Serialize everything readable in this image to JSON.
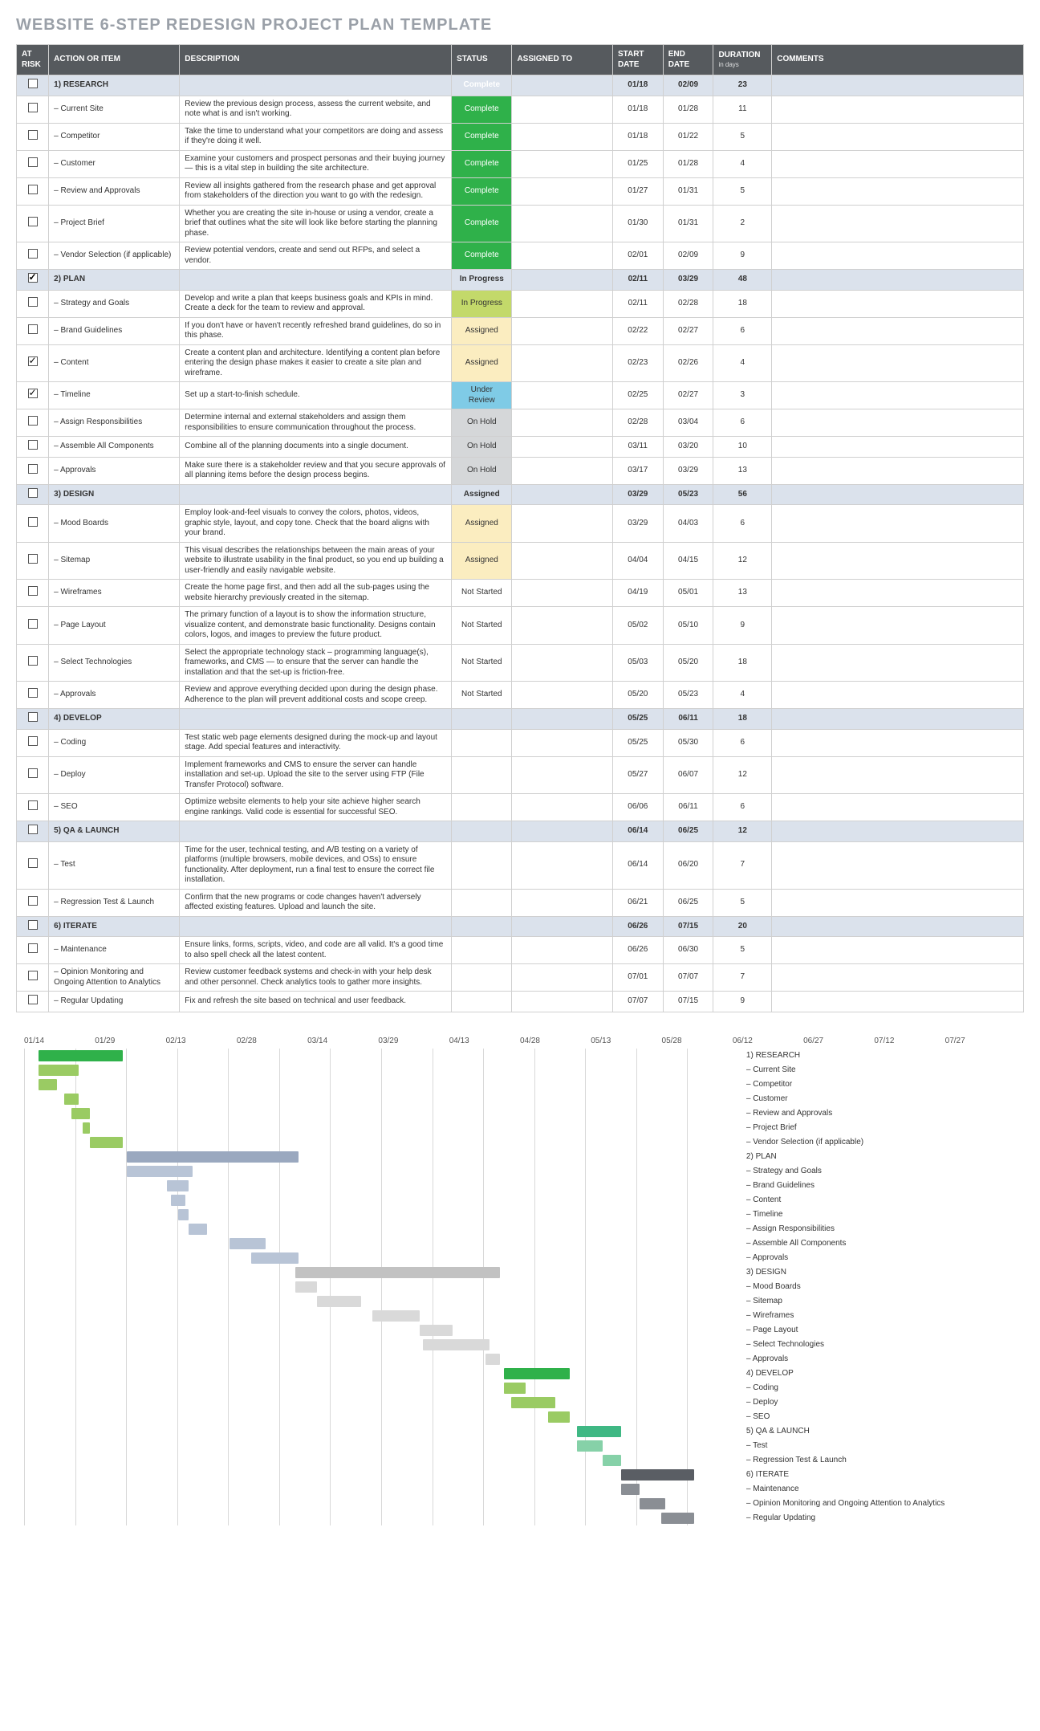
{
  "title": "WEBSITE 6-STEP REDESIGN PROJECT PLAN TEMPLATE",
  "columns": {
    "risk": "AT RISK",
    "action": "ACTION OR ITEM",
    "desc": "DESCRIPTION",
    "status": "STATUS",
    "assigned": "ASSIGNED TO",
    "start": "START DATE",
    "end": "END DATE",
    "duration": "DURATION",
    "duration_sub": "in days",
    "comments": "COMMENTS"
  },
  "status_labels": {
    "complete": "Complete",
    "inprogress": "In Progress",
    "assigned": "Assigned",
    "underreview": "Under Review",
    "onhold": "On Hold",
    "notstarted": "Not Started"
  },
  "rows": [
    {
      "phase": true,
      "checked": false,
      "action": "1) RESEARCH",
      "desc": "",
      "status": "complete",
      "start": "01/18",
      "end": "02/09",
      "dur": "23"
    },
    {
      "checked": false,
      "action": "– Current Site",
      "desc": "Review the previous design process, assess the current website, and note what is and isn't working.",
      "status": "complete",
      "start": "01/18",
      "end": "01/28",
      "dur": "11"
    },
    {
      "checked": false,
      "action": "– Competitor",
      "desc": "Take the time to understand what your competitors are doing and assess if they're doing it well.",
      "status": "complete",
      "start": "01/18",
      "end": "01/22",
      "dur": "5"
    },
    {
      "checked": false,
      "action": "– Customer",
      "desc": "Examine your customers and prospect personas and their buying journey — this is a vital step in building the site architecture.",
      "status": "complete",
      "start": "01/25",
      "end": "01/28",
      "dur": "4"
    },
    {
      "checked": false,
      "action": "– Review and Approvals",
      "desc": "Review all insights gathered from the research phase and get approval from stakeholders of the direction you want to go with the redesign.",
      "status": "complete",
      "start": "01/27",
      "end": "01/31",
      "dur": "5"
    },
    {
      "checked": false,
      "action": "– Project Brief",
      "desc": "Whether you are creating the site in-house or using a vendor, create a brief that outlines what the site will look like before starting the planning phase.",
      "status": "complete",
      "start": "01/30",
      "end": "01/31",
      "dur": "2"
    },
    {
      "checked": false,
      "action": "– Vendor Selection (if applicable)",
      "desc": "Review potential vendors, create and send out RFPs, and select a vendor.",
      "status": "complete",
      "start": "02/01",
      "end": "02/09",
      "dur": "9"
    },
    {
      "phase": true,
      "checked": true,
      "action": "2) PLAN",
      "desc": "",
      "status": "inprogress",
      "start": "02/11",
      "end": "03/29",
      "dur": "48"
    },
    {
      "checked": false,
      "action": "– Strategy and Goals",
      "desc": "Develop and write a plan that keeps business goals and KPIs in mind. Create a deck for the team to review and approval.",
      "status": "inprogress",
      "start": "02/11",
      "end": "02/28",
      "dur": "18"
    },
    {
      "checked": false,
      "action": "– Brand Guidelines",
      "desc": "If you don't have or haven't recently refreshed brand guidelines, do so in this phase.",
      "status": "assigned",
      "start": "02/22",
      "end": "02/27",
      "dur": "6"
    },
    {
      "checked": true,
      "action": "– Content",
      "desc": "Create a content plan and architecture. Identifying a content plan before entering the design phase makes it easier to create a site plan and wireframe.",
      "status": "assigned",
      "start": "02/23",
      "end": "02/26",
      "dur": "4"
    },
    {
      "checked": true,
      "action": "– Timeline",
      "desc": "Set up a start-to-finish schedule.",
      "status": "underreview",
      "start": "02/25",
      "end": "02/27",
      "dur": "3"
    },
    {
      "checked": false,
      "action": "– Assign Responsibilities",
      "desc": "Determine internal and external stakeholders and assign them responsibilities to ensure communication throughout the process.",
      "status": "onhold",
      "start": "02/28",
      "end": "03/04",
      "dur": "6"
    },
    {
      "checked": false,
      "action": "– Assemble All Components",
      "desc": "Combine all of the planning documents into a single document.",
      "status": "onhold",
      "start": "03/11",
      "end": "03/20",
      "dur": "10"
    },
    {
      "checked": false,
      "action": "– Approvals",
      "desc": "Make sure there is a stakeholder review and that you secure approvals of all planning items before the design process begins.",
      "status": "onhold",
      "start": "03/17",
      "end": "03/29",
      "dur": "13"
    },
    {
      "phase": true,
      "checked": false,
      "action": "3) DESIGN",
      "desc": "",
      "status": "assigned",
      "start": "03/29",
      "end": "05/23",
      "dur": "56"
    },
    {
      "checked": false,
      "action": "– Mood Boards",
      "desc": "Employ look-and-feel visuals to convey the colors, photos, videos, graphic style, layout, and copy tone. Check that the board aligns with your brand.",
      "status": "assigned",
      "start": "03/29",
      "end": "04/03",
      "dur": "6"
    },
    {
      "checked": false,
      "action": "– Sitemap",
      "desc": "This visual describes the relationships between the main areas of your website to illustrate usability in the final product, so you end up building a user-friendly and easily navigable website.",
      "status": "assigned",
      "start": "04/04",
      "end": "04/15",
      "dur": "12"
    },
    {
      "checked": false,
      "action": "– Wireframes",
      "desc": "Create the home page first, and then add all the sub-pages using the website hierarchy previously created in the sitemap.",
      "status": "notstarted",
      "start": "04/19",
      "end": "05/01",
      "dur": "13"
    },
    {
      "checked": false,
      "action": "– Page Layout",
      "desc": "The primary function of a layout is to show the information structure, visualize content, and demonstrate basic functionality. Designs contain colors, logos, and images to preview the future product.",
      "status": "notstarted",
      "start": "05/02",
      "end": "05/10",
      "dur": "9"
    },
    {
      "checked": false,
      "action": "– Select Technologies",
      "desc": "Select the appropriate technology stack – programming language(s), frameworks, and CMS — to ensure that the server can handle the installation and that the set-up is friction-free.",
      "status": "notstarted",
      "start": "05/03",
      "end": "05/20",
      "dur": "18"
    },
    {
      "checked": false,
      "action": "– Approvals",
      "desc": "Review and approve everything decided upon during the design phase. Adherence to the plan will prevent additional costs and scope creep.",
      "status": "notstarted",
      "start": "05/20",
      "end": "05/23",
      "dur": "4"
    },
    {
      "phase": true,
      "checked": false,
      "action": "4) DEVELOP",
      "desc": "",
      "status": "",
      "start": "05/25",
      "end": "06/11",
      "dur": "18"
    },
    {
      "checked": false,
      "action": "– Coding",
      "desc": "Test static web page elements designed during the mock-up and layout stage. Add special features and interactivity.",
      "status": "",
      "start": "05/25",
      "end": "05/30",
      "dur": "6"
    },
    {
      "checked": false,
      "action": "– Deploy",
      "desc": "Implement frameworks and CMS to ensure the server can handle installation and set-up. Upload the site to the server using FTP (File Transfer Protocol) software.",
      "status": "",
      "start": "05/27",
      "end": "06/07",
      "dur": "12"
    },
    {
      "checked": false,
      "action": "– SEO",
      "desc": "Optimize website elements to help your site achieve higher search engine rankings. Valid code is essential for successful SEO.",
      "status": "",
      "start": "06/06",
      "end": "06/11",
      "dur": "6"
    },
    {
      "phase": true,
      "checked": false,
      "action": "5) QA & LAUNCH",
      "desc": "",
      "status": "",
      "start": "06/14",
      "end": "06/25",
      "dur": "12"
    },
    {
      "checked": false,
      "action": "– Test",
      "desc": "Time for the user, technical testing, and A/B testing on a variety of platforms (multiple browsers, mobile devices, and OSs) to ensure functionality. After deployment, run a final test to ensure the correct file installation.",
      "status": "",
      "start": "06/14",
      "end": "06/20",
      "dur": "7"
    },
    {
      "checked": false,
      "action": "– Regression Test & Launch",
      "desc": "Confirm that the new programs or code changes haven't adversely affected existing features. Upload and launch the site.",
      "status": "",
      "start": "06/21",
      "end": "06/25",
      "dur": "5"
    },
    {
      "phase": true,
      "checked": false,
      "action": "6) ITERATE",
      "desc": "",
      "status": "",
      "start": "06/26",
      "end": "07/15",
      "dur": "20"
    },
    {
      "checked": false,
      "action": "– Maintenance",
      "desc": "Ensure links, forms, scripts, video, and code are all valid. It's a good time to also spell check all the latest content.",
      "status": "",
      "start": "06/26",
      "end": "06/30",
      "dur": "5"
    },
    {
      "checked": false,
      "action": "– Opinion Monitoring and Ongoing Attention to Analytics",
      "desc": "Review customer feedback systems and check-in with your help desk and other personnel. Check analytics tools to gather more insights.",
      "status": "",
      "start": "07/01",
      "end": "07/07",
      "dur": "7"
    },
    {
      "checked": false,
      "action": "– Regular Updating",
      "desc": "Fix and refresh the site based on technical and user feedback.",
      "status": "",
      "start": "07/07",
      "end": "07/15",
      "dur": "9"
    }
  ],
  "chart_data": {
    "type": "bar",
    "title": "",
    "x_ticks": [
      "01/14",
      "01/29",
      "02/13",
      "02/28",
      "03/14",
      "03/29",
      "04/13",
      "04/28",
      "05/13",
      "05/28",
      "06/12",
      "06/27",
      "07/12",
      "07/27"
    ],
    "x_range_days": [
      0,
      195
    ],
    "series": [
      {
        "name": "1) RESEARCH",
        "start": "01/18",
        "end": "02/09",
        "color": "green",
        "phase": true
      },
      {
        "name": "– Current Site",
        "start": "01/18",
        "end": "01/28",
        "color": "lgreen"
      },
      {
        "name": "– Competitor",
        "start": "01/18",
        "end": "01/22",
        "color": "lgreen"
      },
      {
        "name": "– Customer",
        "start": "01/25",
        "end": "01/28",
        "color": "lgreen"
      },
      {
        "name": "– Review and Approvals",
        "start": "01/27",
        "end": "01/31",
        "color": "lgreen"
      },
      {
        "name": "– Project Brief",
        "start": "01/30",
        "end": "01/31",
        "color": "lgreen"
      },
      {
        "name": "– Vendor Selection (if applicable)",
        "start": "02/01",
        "end": "02/09",
        "color": "lgreen"
      },
      {
        "name": "2) PLAN",
        "start": "02/11",
        "end": "03/29",
        "color": "blue",
        "phase": true
      },
      {
        "name": "– Strategy and Goals",
        "start": "02/11",
        "end": "02/28",
        "color": "lblue"
      },
      {
        "name": "– Brand Guidelines",
        "start": "02/22",
        "end": "02/27",
        "color": "lblue"
      },
      {
        "name": "– Content",
        "start": "02/23",
        "end": "02/26",
        "color": "lblue"
      },
      {
        "name": "– Timeline",
        "start": "02/25",
        "end": "02/27",
        "color": "lblue"
      },
      {
        "name": "– Assign Responsibilities",
        "start": "02/28",
        "end": "03/04",
        "color": "lblue"
      },
      {
        "name": "– Assemble All Components",
        "start": "03/11",
        "end": "03/20",
        "color": "lblue"
      },
      {
        "name": "– Approvals",
        "start": "03/17",
        "end": "03/29",
        "color": "lblue"
      },
      {
        "name": "3) DESIGN",
        "start": "03/29",
        "end": "05/23",
        "color": "grey",
        "phase": true
      },
      {
        "name": "– Mood Boards",
        "start": "03/29",
        "end": "04/03",
        "color": "lgrey"
      },
      {
        "name": "– Sitemap",
        "start": "04/04",
        "end": "04/15",
        "color": "lgrey"
      },
      {
        "name": "– Wireframes",
        "start": "04/19",
        "end": "05/01",
        "color": "lgrey"
      },
      {
        "name": "– Page Layout",
        "start": "05/02",
        "end": "05/10",
        "color": "lgrey"
      },
      {
        "name": "– Select Technologies",
        "start": "05/03",
        "end": "05/20",
        "color": "lgrey"
      },
      {
        "name": "– Approvals",
        "start": "05/20",
        "end": "05/23",
        "color": "lgrey"
      },
      {
        "name": "4) DEVELOP",
        "start": "05/25",
        "end": "06/11",
        "color": "green",
        "phase": true
      },
      {
        "name": "– Coding",
        "start": "05/25",
        "end": "05/30",
        "color": "lgreen"
      },
      {
        "name": "– Deploy",
        "start": "05/27",
        "end": "06/07",
        "color": "lgreen"
      },
      {
        "name": "– SEO",
        "start": "06/06",
        "end": "06/11",
        "color": "lgreen"
      },
      {
        "name": "5) QA & LAUNCH",
        "start": "06/14",
        "end": "06/25",
        "color": "teal",
        "phase": true
      },
      {
        "name": "– Test",
        "start": "06/14",
        "end": "06/20",
        "color": "lteal"
      },
      {
        "name": "– Regression Test & Launch",
        "start": "06/21",
        "end": "06/25",
        "color": "lteal"
      },
      {
        "name": "6) ITERATE",
        "start": "06/26",
        "end": "07/15",
        "color": "dgrey",
        "phase": true
      },
      {
        "name": "– Maintenance",
        "start": "06/26",
        "end": "06/30",
        "color": "mgrey"
      },
      {
        "name": "– Opinion Monitoring and Ongoing Attention to Analytics",
        "start": "07/01",
        "end": "07/07",
        "color": "mgrey"
      },
      {
        "name": "– Regular Updating",
        "start": "07/07",
        "end": "07/15",
        "color": "mgrey"
      }
    ]
  }
}
